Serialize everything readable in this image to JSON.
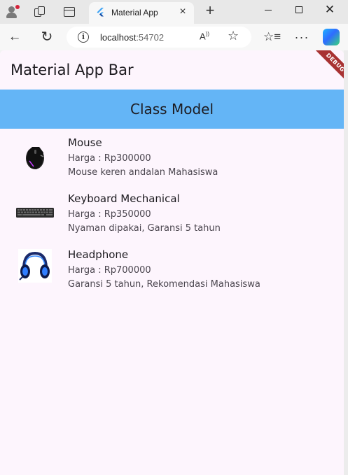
{
  "browser": {
    "tab_title": "Material App",
    "url_host": "localhost",
    "url_port": ":54702",
    "icons": {
      "profile": "profile-icon",
      "workspaces": "workspaces-icon",
      "tab_actions": "tab-actions-icon",
      "close_tab": "close-icon",
      "new_tab": "plus-icon",
      "back": "arrow-left-icon",
      "reload": "reload-icon",
      "info": "info-icon",
      "read_aloud": "read-aloud-icon",
      "favorite": "star-icon",
      "favorites": "favorites-icon",
      "more": "more-icon",
      "copilot": "copilot-icon"
    }
  },
  "app": {
    "appbar_title": "Material App Bar",
    "debug_label": "DEBUG",
    "header_title": "Class Model",
    "colors": {
      "background": "#fdf5fd",
      "header": "#64b5f6",
      "debug_ribbon": "#a83232"
    },
    "products": [
      {
        "name": "Mouse",
        "price": "Harga : Rp300000",
        "description": "Mouse keren andalan Mahasiswa",
        "image": "mouse-image"
      },
      {
        "name": "Keyboard Mechanical",
        "price": "Harga : Rp350000",
        "description": "Nyaman dipakai, Garansi 5 tahun",
        "image": "keyboard-image"
      },
      {
        "name": "Headphone",
        "price": "Harga : Rp700000",
        "description": "Garansi 5 tahun, Rekomendasi Mahasiswa",
        "image": "headphone-image"
      }
    ]
  }
}
